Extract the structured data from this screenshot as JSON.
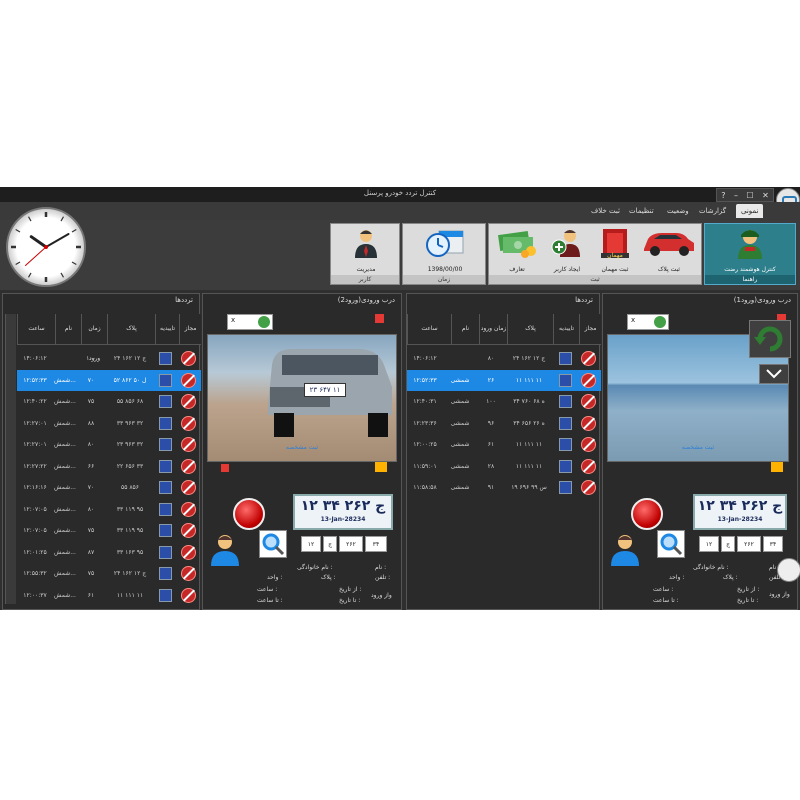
{
  "window": {
    "title": "کنترل تردد خودرو پرسنل"
  },
  "menu": {
    "tabs": [
      "نمونی",
      "گزارشات",
      "وضعیت",
      "تنظیمات",
      "ثبت خلاف"
    ],
    "active": 0
  },
  "ribbon": {
    "groups": [
      {
        "label": "راهنما",
        "items": [
          {
            "label": "کنترل هوشمند رضت",
            "icon": "guard-icon"
          }
        ]
      },
      {
        "label": "ثبت",
        "items": [
          {
            "label": "ثبت پلاک",
            "icon": "car-icon"
          },
          {
            "label": "ثبت مهمان",
            "icon": "guest-icon"
          },
          {
            "label": "ایجاد کاربر",
            "icon": "add-user-icon"
          },
          {
            "label": "تعارف",
            "icon": "money-icon"
          }
        ]
      },
      {
        "label": "زمان",
        "items": [
          {
            "label": "1398/00/00",
            "icon": "calendar-clock-icon"
          }
        ]
      },
      {
        "label": "کاربر",
        "items": [
          {
            "label": "مدیریت",
            "icon": "manager-icon"
          }
        ]
      }
    ]
  },
  "clock": {
    "hour": 10,
    "minute": 10,
    "second": 38
  },
  "gate1": {
    "title": "درب ورودی(ورود1)",
    "camera_caption": "ثبت مشخصه",
    "plate_text": "۱۲ ج ۲۶۲ ۳۴",
    "plate_date": "13-Jan-28234",
    "plate_parts": [
      "۳۴",
      "۲۶۲",
      "ج",
      "۱۲"
    ],
    "check_value": "x",
    "fields": {
      "name": "نام :",
      "family": "نام خانوادگی :",
      "phone": "تلفن :",
      "plate": "پلاک :",
      "unit": "واحد :",
      "from_date": "از تاریخ :",
      "time": "ساعت :",
      "to_date": "تا تاریخ :",
      "to_time": "تا ساعت :",
      "entry": "واز ورود"
    }
  },
  "gate2": {
    "title": "درب ورودی(ورود2)",
    "camera_caption": "ثبت مشخصه",
    "plate_text": "۱۲ ج ۲۶۲ ۳۴",
    "plate_date": "13-Jan-28234",
    "plate_parts": [
      "۳۴",
      "۲۶۲",
      "ج",
      "۱۲"
    ],
    "check_value": "x",
    "car_plate": "۲۳ ۶۴۷ ۱۱",
    "fields": {
      "name": "نام :",
      "family": "نام خانوادگی :",
      "phone": "تلفن :",
      "plate": "پلاک :",
      "unit": "واحد :",
      "from_date": "از تاریخ :",
      "time": "ساعت :",
      "to_date": "تا تاریخ :",
      "to_time": "تا ساعت :",
      "entry": "واز ورود"
    }
  },
  "traffic1": {
    "title": "ترددها",
    "headers": [
      "مجاز",
      "تاییدیه",
      "پلاک",
      "نام",
      "زمان ورود",
      "ساعت"
    ],
    "rows": [
      {
        "plate": "۲۴ ۱۶۲ ج ۱۲",
        "type": "۸۰",
        "name": "",
        "time": "۱۴:۰۶:۱۲",
        "selected": false
      },
      {
        "plate": "۱۱ ۱۱۱ ۱۱",
        "type": "۲۶",
        "name": "شمشی",
        "time": "۱۲:۵۲:۳۳",
        "selected": true
      },
      {
        "plate": "۳۴ ۷۶۰ ه ۶۸",
        "type": "۱۰۰",
        "name": "شمشی",
        "time": "۱۲:۴۰:۳۱",
        "selected": false
      },
      {
        "plate": "۳۴ ۶۵۶ ه ۲۶",
        "type": "۹۶",
        "name": "شمشی",
        "time": "۱۲:۲۳:۳۶",
        "selected": false
      },
      {
        "plate": "۱۱ ۱۱۱ ۱۱",
        "type": "۶۱",
        "name": "شمشی",
        "time": "۱۲:۰۰:۲۵",
        "selected": false
      },
      {
        "plate": "۱۱ ۱۱۱ ۱۱",
        "type": "۲۸",
        "name": "شمشی",
        "time": "۱۱:۵۹:۰۱",
        "selected": false
      },
      {
        "plate": "۱۹ ۶۹۶ س ۹۹",
        "type": "۹۱",
        "name": "شمشی",
        "time": "۱۱:۵۸:۵۸",
        "selected": false
      }
    ]
  },
  "traffic2": {
    "title": "ترددها",
    "headers": [
      "مجاز",
      "تاییدیه",
      "پلاک",
      "نام",
      "زمان ورود",
      "ساعت"
    ],
    "rows": [
      {
        "plate": "۲۴ ۱۶۲ ج ۱۲",
        "type": "۱۰۰",
        "name": "",
        "time": "۱۴:۰۶:۱۲",
        "selected": false
      },
      {
        "plate": "۵۲ ۸۶۲ ل ۵۰",
        "type": "۷۰",
        "name": "شمش...",
        "time": "۱۲:۵۲:۳۳",
        "selected": true
      },
      {
        "plate": "۵۵ ۸۵۶ ۶۸",
        "type": "۷۵",
        "name": "شمش...",
        "time": "۱۲:۴۰:۲۲",
        "selected": false
      },
      {
        "plate": "۳۳ ۹۶۳ ۳۲",
        "type": "۸۸",
        "name": "شمش...",
        "time": "۱۲:۲۷:۰۱",
        "selected": false
      },
      {
        "plate": "۲۳ ۹۶۳ ۳۲",
        "type": "۸۰",
        "name": "شمش...",
        "time": "۱۲:۲۷:۰۱",
        "selected": false
      },
      {
        "plate": "۲۲ ۶۵۶ ۳۳",
        "type": "۶۶",
        "name": "شمش...",
        "time": "۱۲:۲۷:۲۲",
        "selected": false
      },
      {
        "plate": "۵۵ ۸۵۶",
        "type": "۷۰",
        "name": "شمش...",
        "time": "۱۲:۱۶:۱۶",
        "selected": false
      },
      {
        "plate": "۳۳ ۱۱۹ ۹۵",
        "type": "۸۰",
        "name": "شمش...",
        "time": "۱۲:۰۷:۰۵",
        "selected": false
      },
      {
        "plate": "۳۳ ۱۱۹ ۹۵",
        "type": "۷۵",
        "name": "شمش...",
        "time": "۱۲:۰۷:۰۵",
        "selected": false
      },
      {
        "plate": "۳۳ ۱۶۳ ۹۵",
        "type": "۸۷",
        "name": "شمش...",
        "time": "۱۲:۰۱:۲۵",
        "selected": false
      },
      {
        "plate": "۲۴ ۱۶۲ ج ۱۲",
        "type": "۷۵",
        "name": "شمش...",
        "time": "۱۲:۵۵:۳۲",
        "selected": false
      },
      {
        "plate": "۱۱ ۱۱۱ ۱۱",
        "type": "۶۱",
        "name": "شمش...",
        "time": "۱۲:۰۰:۳۷",
        "selected": false
      }
    ]
  }
}
